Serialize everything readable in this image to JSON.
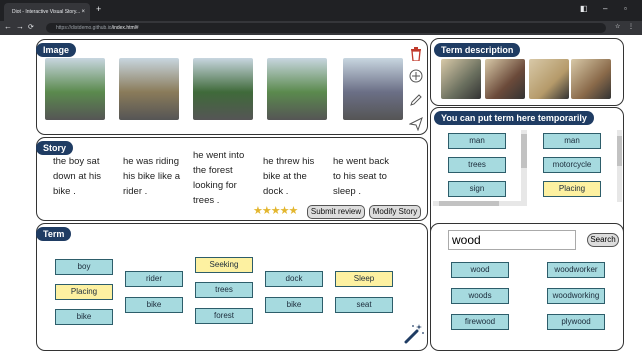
{
  "browser": {
    "tab_title": "Diot - Interactive Visual Story...",
    "tab_close": "×",
    "new_tab": "+",
    "url_host": "https://distdemo.github.io",
    "url_path": "/index.html#"
  },
  "image_panel": {
    "title": "Image",
    "colors": [
      "#5b8a4e",
      "#8a7b5a",
      "#3f6a3a",
      "#5b8a4e",
      "#6b6f86"
    ]
  },
  "side_tools": [
    "trash-icon",
    "plus-circle-icon",
    "pencil-icon",
    "send-icon"
  ],
  "term_desc": {
    "title": "Term description",
    "colors": [
      "#6a6f5e",
      "#6b4a3a",
      "#b59a6a",
      "#8a6a4a"
    ]
  },
  "temp": {
    "title": "You can put term here temporarily",
    "left": [
      "man",
      "trees",
      "sign"
    ],
    "right": [
      "man",
      "motorcycle",
      "Placing"
    ]
  },
  "story": {
    "title": "Story",
    "sentences": [
      "the boy sat down at his bike .",
      "he was riding his bike like a rider .",
      "he went into the forest looking for trees .",
      "he threw his bike at the dock .",
      "he went back to his seat to sleep ."
    ],
    "stars": "★★★★★",
    "submit_label": "Submit review",
    "modify_label": "Modify Story"
  },
  "term_panel": {
    "title": "Term",
    "columns": [
      [
        "boy",
        "Placing",
        "bike"
      ],
      [
        "rider",
        "bike"
      ],
      [
        "Seeking",
        "trees",
        "forest"
      ],
      [
        "dock",
        "bike"
      ],
      [
        "Sleep",
        "seat"
      ]
    ]
  },
  "search": {
    "value": "wood",
    "button_label": "Search",
    "results_left": [
      "wood",
      "woods",
      "firewood"
    ],
    "results_right": [
      "woodworker",
      "woodworking",
      "plywood"
    ]
  }
}
